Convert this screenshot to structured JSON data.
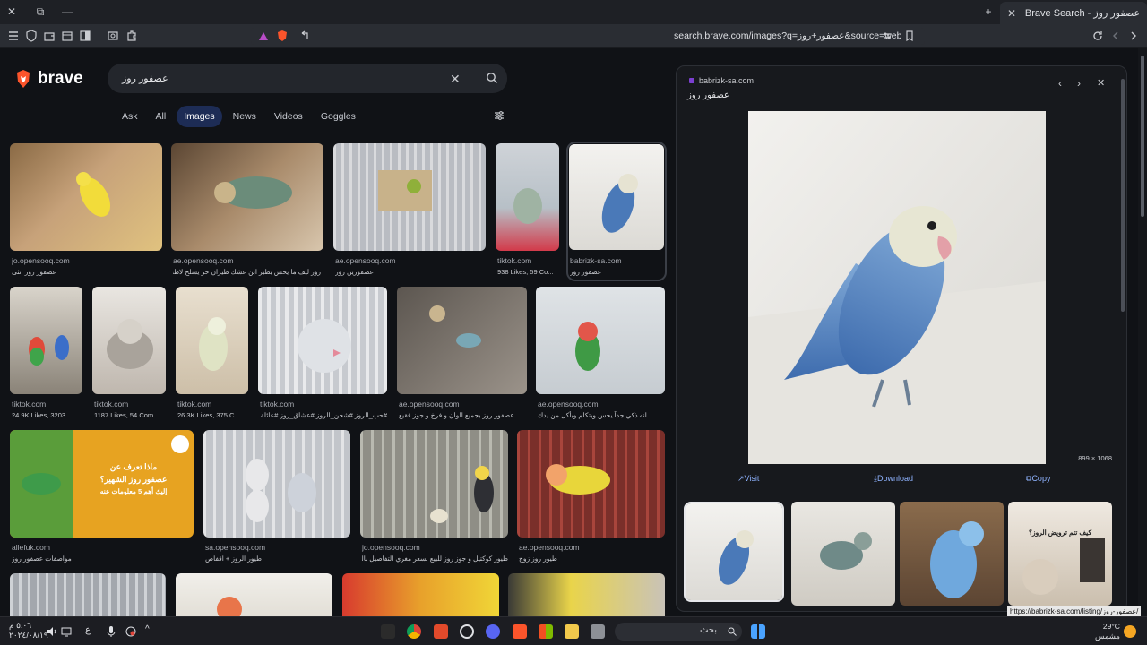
{
  "browser": {
    "tab_title": "Brave Search - عصفور روز",
    "url": "search.brave.com/images?q=عصفور+روز&source=web"
  },
  "search": {
    "logo_text": "brave",
    "query": "عصفور روز",
    "tabs": [
      "Ask",
      "All",
      "Images",
      "News",
      "Videos",
      "Goggles"
    ],
    "active_tab": "Images"
  },
  "results": [
    {
      "source": "jo.opensooq.com",
      "title": "عصفور روز انثى"
    },
    {
      "source": "ae.opensooq.com",
      "title": "روز ليف ما يحس بطير ابن عشك طيران حر يسلح لاطفال"
    },
    {
      "source": "ae.opensooq.com",
      "title": "عصفورين روز"
    },
    {
      "source": "tiktok.com",
      "title": "938 Likes, 59 Co..."
    },
    {
      "source": "babrizk-sa.com",
      "title": "عصفور روز"
    },
    {
      "source": "tiktok.com",
      "title": "24.9K Likes, 3203 ..."
    },
    {
      "source": "tiktok.com",
      "title": "1187 Likes, 54 Com..."
    },
    {
      "source": "tiktok.com",
      "title": "26.3K Likes, 375 C..."
    },
    {
      "source": "tiktok.com",
      "title": "#حب_الروز #شحن_الروز #عشاق_روز #عائلة..."
    },
    {
      "source": "ae.opensooq.com",
      "title": "عصفور روز بجميع الوان و فرخ و جوز فقيع"
    },
    {
      "source": "ae.opensooq.com",
      "title": "انه ذكي جداً يحس ويتكلم ويأكل من يدك"
    },
    {
      "source": "allefuk.com",
      "title": "مواصفات عصفور روز"
    },
    {
      "source": "sa.opensooq.com",
      "title": "طيور الروز + اقفاص"
    },
    {
      "source": "jo.opensooq.com",
      "title": "طيور كوكتيل و جوز روز للبيع بسعر مغري التفاصيل بالوصف"
    },
    {
      "source": "ae.opensooq.com",
      "title": "طيور روز زوج"
    }
  ],
  "promo": {
    "line1": "ماذا تعرف عن",
    "line2": "عصفور روز الشهير؟",
    "line3": "إليك أهم 5 معلومات عنه"
  },
  "panel": {
    "domain": "babrizk-sa.com",
    "title": "عصفور روز",
    "dimensions": "899 × 1068",
    "visit": "Visit",
    "download": "Download",
    "copy": "Copy",
    "thumb_caption": "كيف تتم ترويض الروز؟"
  },
  "status_url": "https://babrizk-sa.com/listing/عصفور-روز/",
  "taskbar": {
    "time": "٥:٠٦ م",
    "date": "٢٠٢٤/٠٨/١٩",
    "lang": "ع",
    "search_placeholder": "بحث",
    "temp": "29°C",
    "weather": "مشمس"
  },
  "colors": {
    "accent": "#1d2c55",
    "link": "#8fb3ff",
    "brave": "#fb542b"
  }
}
